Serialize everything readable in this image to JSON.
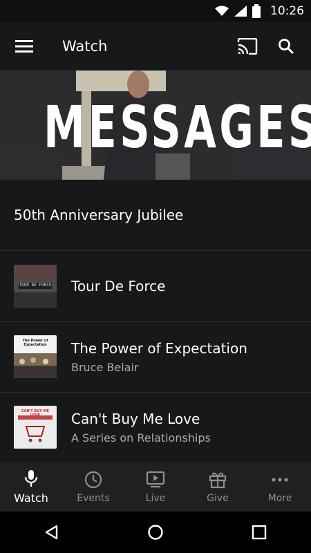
{
  "status": {
    "time": "10:26"
  },
  "app_bar": {
    "title": "Watch"
  },
  "hero": {
    "text": "MESSAGES"
  },
  "featured": {
    "title": "50th Anniversary Jubilee"
  },
  "items": [
    {
      "title": "Tour De Force",
      "subtitle": "",
      "thumb_text": "TOUR DE FORCE"
    },
    {
      "title": "The Power of Expectation",
      "subtitle": "Bruce Belair",
      "thumb_text": "The Power of Expectation"
    },
    {
      "title": "Can't Buy Me Love",
      "subtitle": "A Series on Relationships",
      "thumb_text": "CAN'T BUY ME LOVE"
    }
  ],
  "bottom_nav": [
    {
      "label": "Watch",
      "icon": "microphone-icon",
      "active": true
    },
    {
      "label": "Events",
      "icon": "clock-icon",
      "active": false
    },
    {
      "label": "Live",
      "icon": "tv-play-icon",
      "active": false
    },
    {
      "label": "Give",
      "icon": "gift-icon",
      "active": false
    },
    {
      "label": "More",
      "icon": "more-dots-icon",
      "active": false
    }
  ],
  "colors": {
    "background": "#17181a",
    "active": "#ffffff",
    "inactive": "#8d8f93"
  }
}
